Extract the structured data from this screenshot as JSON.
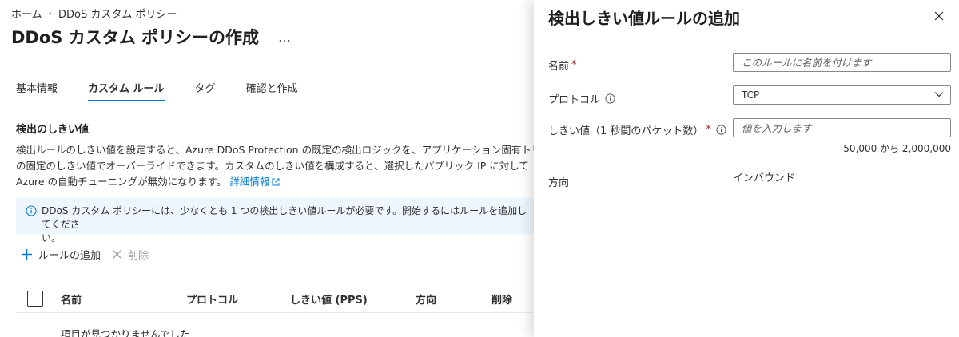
{
  "breadcrumb": {
    "home": "ホーム",
    "current": "DDoS カスタム ポリシー"
  },
  "page": {
    "title": "DDoS カスタム ポリシーの作成",
    "more": "…"
  },
  "tabs": [
    {
      "label": "基本情報",
      "active": false
    },
    {
      "label": "カスタム ルール",
      "active": true
    },
    {
      "label": "タグ",
      "active": false
    },
    {
      "label": "確認と作成",
      "active": false
    }
  ],
  "section": {
    "title": "検出のしきい値",
    "line1": "検出ルールのしきい値を設定すると、Azure DDoS Protection の既定の検出ロジックを、アプリケーション固有トリガー",
    "line2": "の固定のしきい値でオーバーライドできます。カスタムのしきい値を構成すると、選択したパブリック IP に対して",
    "line3": "Azure の自動チューニングが無効になります。",
    "link": "詳細情報"
  },
  "banner": {
    "line1": "DDoS カスタム ポリシーには、少なくとも 1 つの検出しきい値ルールが必要です。開始するにはルールを追加してくださ",
    "line2": "い。"
  },
  "toolbar": {
    "add": "ルールの追加",
    "delete": "削除"
  },
  "table": {
    "columns": [
      "名前",
      "プロトコル",
      "しきい値 (PPS)",
      "方向",
      "削除"
    ],
    "empty": "項目が見つかりませんでした"
  },
  "panel": {
    "title": "検出しきい値ルールの追加",
    "name_label": "名前",
    "name_required": "*",
    "name_placeholder": "このルールに名前を付けます",
    "protocol_label": "プロトコル",
    "protocol_value": "TCP",
    "threshold_label": "しきい値（1 秒間のパケット数）",
    "threshold_required": "*",
    "threshold_placeholder": "値を入力します",
    "threshold_range": "50,000 から 2,000,000",
    "direction_label": "方向",
    "direction_value": "インバウンド"
  },
  "colors": {
    "accent": "#0078d4",
    "banner_bg": "#f0f6ff",
    "required": "#a4262c"
  }
}
